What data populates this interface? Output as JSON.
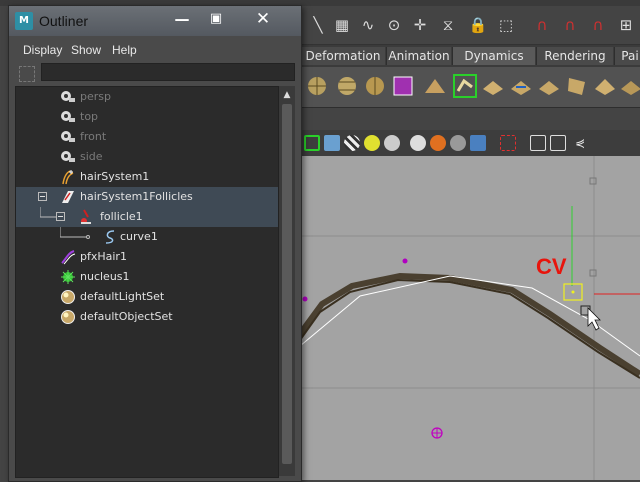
{
  "outliner": {
    "title": "Outliner",
    "menus": [
      "Display",
      "Show",
      "Help"
    ],
    "filter_value": "",
    "items": [
      {
        "label": "persp",
        "icon": "camera-icon",
        "dimmed": true
      },
      {
        "label": "top",
        "icon": "camera-icon",
        "dimmed": true
      },
      {
        "label": "front",
        "icon": "camera-icon",
        "dimmed": true
      },
      {
        "label": "side",
        "icon": "camera-icon",
        "dimmed": true
      },
      {
        "label": "hairSystem1",
        "icon": "hair-system-icon",
        "dimmed": false
      },
      {
        "label": "hairSystem1Follicles",
        "icon": "transform-group-icon",
        "dimmed": false,
        "selected": true
      },
      {
        "label": "follicle1",
        "icon": "follicle-icon",
        "dimmed": false,
        "selected": true
      },
      {
        "label": "curve1",
        "icon": "curve-icon",
        "dimmed": false
      },
      {
        "label": "pfxHair1",
        "icon": "pfx-hair-icon",
        "dimmed": false
      },
      {
        "label": "nucleus1",
        "icon": "nucleus-icon",
        "dimmed": false
      },
      {
        "label": "defaultLightSet",
        "icon": "set-icon",
        "dimmed": false
      },
      {
        "label": "defaultObjectSet",
        "icon": "set-icon",
        "dimmed": false
      }
    ]
  },
  "maya": {
    "shelf_tabs": [
      "Deformation",
      "Animation",
      "Dynamics",
      "Rendering",
      "Pai"
    ],
    "viewport": {
      "annotation": "CV",
      "annotation_color": "#e8140c",
      "background": "#a3a3a3"
    }
  },
  "colors": {
    "selected_row": "#3f4a55",
    "tree_bg": "#2b2b2b",
    "title_gradient_top": "#6b7076"
  }
}
